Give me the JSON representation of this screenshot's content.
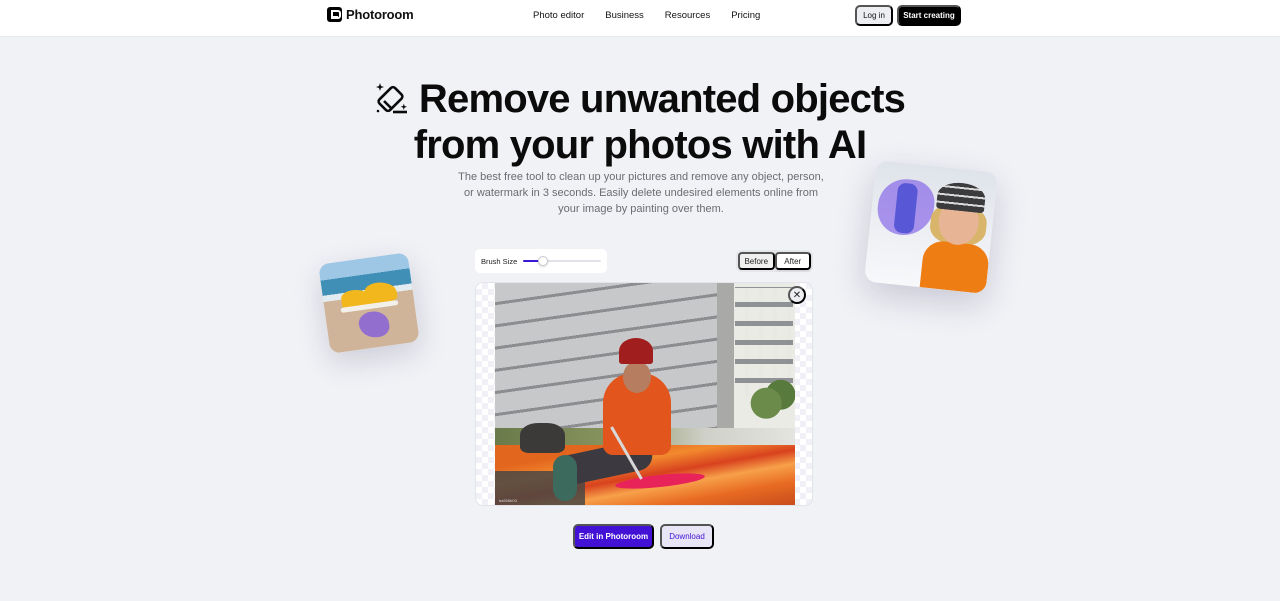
{
  "header": {
    "brand": "Photoroom",
    "nav": [
      "Photo editor",
      "Business",
      "Resources",
      "Pricing"
    ],
    "login_label": "Log in",
    "start_label": "Start creating"
  },
  "hero": {
    "title_line1": "Remove unwanted objects",
    "title_line2": "from your photos with AI",
    "subtitle": "The best free tool to clean up your pictures and remove any object, person, or watermark in 3 seconds. Easily delete undesired elements online from your image by painting over them.",
    "title_icon": "eraser-sparkle-icon"
  },
  "editor": {
    "brush_label": "Brush Size",
    "brush_size_fraction": 0.25,
    "toggle_options": [
      "Before",
      "After"
    ],
    "active_view": "After",
    "close_icon": "close-icon",
    "image_watermark": "ba926b03"
  },
  "actions": {
    "edit_label": "Edit in Photoroom",
    "download_label": "Download"
  },
  "colors": {
    "brand": "#4311d6",
    "background": "#f1f2f6",
    "download_bg": "#e7e5f6"
  }
}
